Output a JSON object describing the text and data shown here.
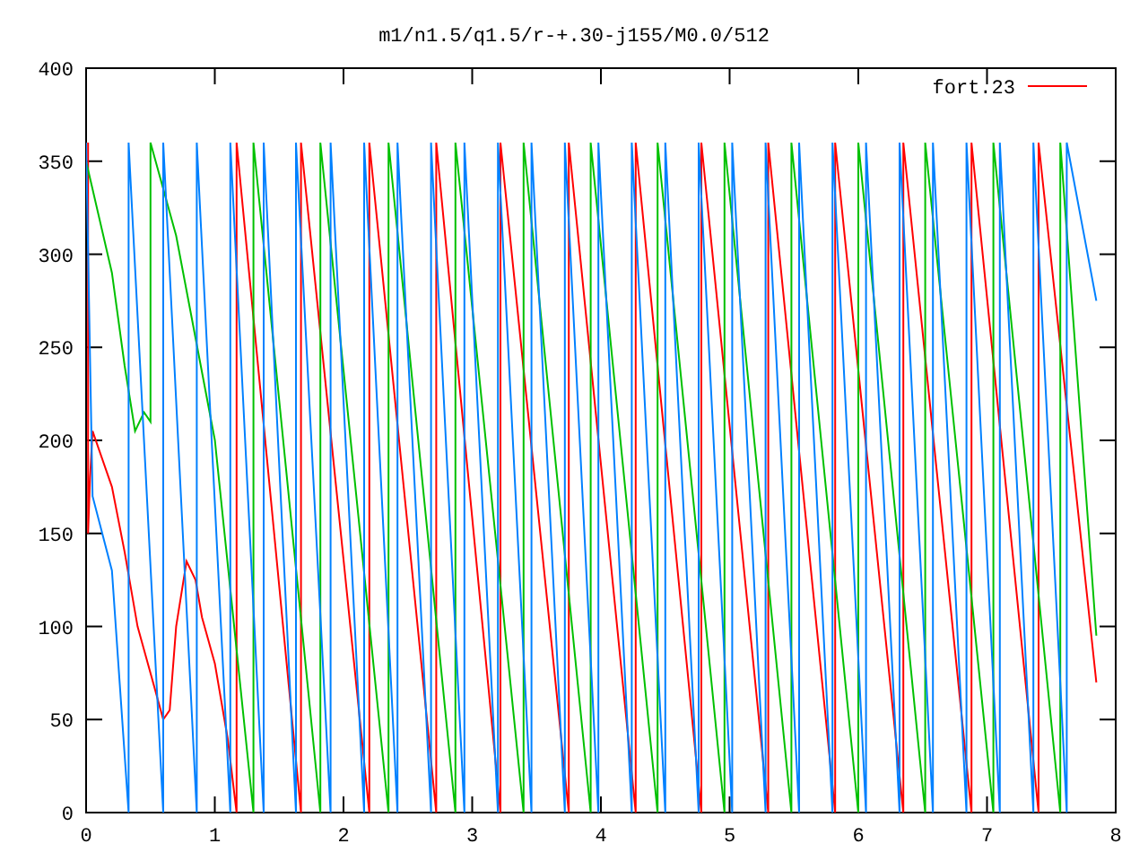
{
  "chart_data": {
    "type": "line",
    "title": "m1/n1.5/q1.5/r-+.30-j155/M0.0/512",
    "xlim": [
      0,
      8
    ],
    "ylim": [
      0,
      400
    ],
    "xticks": [
      0,
      1,
      2,
      3,
      4,
      5,
      6,
      7,
      8
    ],
    "yticks": [
      0,
      50,
      100,
      150,
      200,
      250,
      300,
      350,
      400
    ],
    "series": [
      {
        "name": "fort.23",
        "color": "#ff0000",
        "x": [
          0.015,
          0.015,
          0.03,
          0.05,
          0.1,
          0.2,
          0.3,
          0.4,
          0.5,
          0.6,
          0.65,
          0.7,
          0.78,
          0.85,
          0.9,
          1.0,
          1.1,
          1.17,
          1.17,
          1.67,
          1.67,
          2.2,
          2.2,
          2.72,
          2.72,
          3.22,
          3.22,
          3.75,
          3.75,
          4.27,
          4.27,
          4.78,
          4.78,
          5.3,
          5.3,
          5.82,
          5.82,
          6.35,
          6.35,
          6.88,
          6.88,
          7.4,
          7.4,
          7.85
        ],
        "values": [
          360,
          150,
          180,
          205,
          195,
          175,
          140,
          100,
          75,
          50,
          55,
          100,
          135,
          125,
          105,
          80,
          40,
          0,
          360,
          0,
          360,
          0,
          360,
          0,
          360,
          0,
          360,
          0,
          360,
          0,
          360,
          0,
          360,
          0,
          360,
          0,
          360,
          0,
          360,
          0,
          360,
          0,
          360,
          70
        ]
      },
      {
        "color": "#00c000",
        "x": [
          0,
          0.1,
          0.2,
          0.3,
          0.38,
          0.45,
          0.5,
          0.5,
          0.7,
          1.0,
          1.3,
          1.3,
          1.82,
          1.82,
          2.35,
          2.35,
          2.87,
          2.87,
          3.4,
          3.4,
          3.92,
          3.92,
          4.44,
          4.44,
          4.96,
          4.96,
          5.48,
          5.48,
          6.0,
          6.0,
          6.52,
          6.52,
          7.05,
          7.05,
          7.57,
          7.57,
          7.85
        ],
        "values": [
          350,
          320,
          290,
          240,
          205,
          215,
          210,
          360,
          310,
          200,
          0,
          360,
          0,
          360,
          0,
          360,
          0,
          360,
          0,
          360,
          0,
          360,
          0,
          360,
          0,
          360,
          0,
          360,
          0,
          360,
          0,
          360,
          0,
          360,
          0,
          360,
          95
        ]
      },
      {
        "color": "#0080ff",
        "x": [
          0,
          0.05,
          0.2,
          0.33,
          0.33,
          0.6,
          0.6,
          0.86,
          0.86,
          1.12,
          1.12,
          1.38,
          1.38,
          1.63,
          1.63,
          1.9,
          1.9,
          2.16,
          2.16,
          2.42,
          2.42,
          2.68,
          2.68,
          2.94,
          2.94,
          3.2,
          3.2,
          3.46,
          3.46,
          3.72,
          3.72,
          3.98,
          3.98,
          4.24,
          4.24,
          4.5,
          4.5,
          4.76,
          4.76,
          5.02,
          5.02,
          5.28,
          5.28,
          5.54,
          5.54,
          5.8,
          5.8,
          6.06,
          6.06,
          6.32,
          6.32,
          6.58,
          6.58,
          6.84,
          6.84,
          7.1,
          7.1,
          7.36,
          7.36,
          7.62,
          7.62,
          7.85
        ],
        "values": [
          360,
          170,
          130,
          0,
          360,
          0,
          360,
          0,
          360,
          0,
          360,
          0,
          360,
          0,
          360,
          0,
          360,
          0,
          360,
          0,
          360,
          0,
          360,
          0,
          360,
          0,
          360,
          0,
          360,
          0,
          360,
          0,
          360,
          0,
          360,
          0,
          360,
          0,
          360,
          0,
          360,
          0,
          360,
          0,
          360,
          0,
          360,
          0,
          360,
          0,
          360,
          0,
          360,
          0,
          360,
          0,
          360,
          0,
          360,
          0,
          360,
          275
        ]
      }
    ]
  }
}
